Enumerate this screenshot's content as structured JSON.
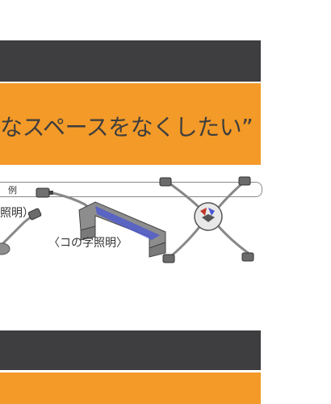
{
  "headline": "なスペースをなくしたい”",
  "example_label": "例",
  "captions": {
    "left": "照明）",
    "middle": "〈コの字照明〉"
  },
  "bottom_text": "",
  "colors": {
    "dark_band": "#3e3e40",
    "orange": "#f39a28",
    "text": "#3d3d3d",
    "led_blue": "#4a57d6"
  }
}
